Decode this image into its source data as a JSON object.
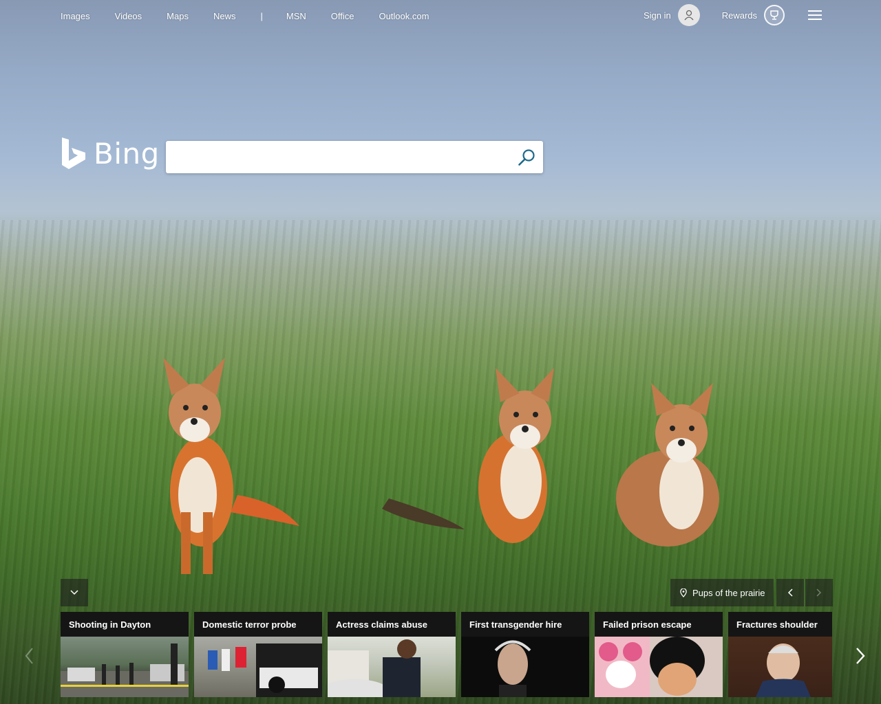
{
  "nav": {
    "links": [
      "Images",
      "Videos",
      "Maps",
      "News"
    ],
    "separator": "|",
    "links2": [
      "MSN",
      "Office",
      "Outlook.com"
    ]
  },
  "header": {
    "signin_label": "Sign in",
    "rewards_label": "Rewards"
  },
  "logo": {
    "text": "Bing"
  },
  "search": {
    "value": "",
    "placeholder": ""
  },
  "image_info": {
    "title": "Pups of the prairie"
  },
  "news": [
    {
      "title": "Shooting in Dayton"
    },
    {
      "title": "Domestic terror probe"
    },
    {
      "title": "Actress claims abuse"
    },
    {
      "title": "First transgender hire"
    },
    {
      "title": "Failed prison escape"
    },
    {
      "title": "Fractures shoulder"
    }
  ],
  "icons": {
    "search": "search-icon",
    "avatar": "user-icon",
    "rewards": "trophy-icon",
    "menu": "hamburger-icon",
    "collapse": "chevron-down-icon",
    "location": "location-pin-icon"
  },
  "colors": {
    "search_icon": "#1e6a8a",
    "control_bg": "#1e1e1e"
  }
}
